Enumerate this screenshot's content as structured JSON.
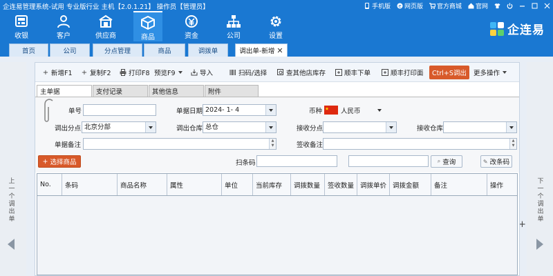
{
  "app_title": "企连易管理系统-试用 专业版行业 主机【2.0.1.21】 操作员【管理员】",
  "top_links": [
    {
      "label": "手机版",
      "icon": "mobile-icon"
    },
    {
      "label": "网页版",
      "icon": "ie-browser-icon"
    },
    {
      "label": "官方商城",
      "icon": "cart-icon"
    },
    {
      "label": "官网",
      "icon": "home-icon"
    }
  ],
  "nav_items": [
    {
      "label": "收银",
      "icon": "register-icon"
    },
    {
      "label": "客户",
      "icon": "customer-icon"
    },
    {
      "label": "供应商",
      "icon": "supplier-icon"
    },
    {
      "label": "商品",
      "icon": "product-box-icon"
    },
    {
      "label": "资金",
      "icon": "money-icon"
    },
    {
      "label": "公司",
      "icon": "company-org-icon"
    },
    {
      "label": "设置",
      "icon": "gear-icon"
    }
  ],
  "active_nav": "商品",
  "brand": "企连易",
  "tabs": [
    {
      "label": "首页"
    },
    {
      "label": "公司"
    },
    {
      "label": "分点管理"
    },
    {
      "label": "商品"
    },
    {
      "label": "调拨单"
    },
    {
      "label": "调出单-新增",
      "active": true
    }
  ],
  "toolbar": {
    "new": "新增F1",
    "copy": "复制F2",
    "print": "打印F8",
    "preview": "预览F9",
    "import": "导入",
    "scan": "扫码/选择",
    "check_stock": "查其他店库存",
    "sf_order": "顺丰下单",
    "sf_print": "顺丰打印面",
    "ctrl_s": "Ctrl+S调出",
    "more": "更多操作"
  },
  "subtabs": [
    "主单据",
    "支付记录",
    "其他信息",
    "附件"
  ],
  "form": {
    "order_no_label": "单号",
    "order_no_value": "",
    "date_label": "单据日期",
    "date_value": "2024- 1- 4",
    "currency_label": "币种",
    "currency_value": "人民币",
    "out_branch_label": "调出分点",
    "out_branch_value": "北京分部",
    "out_wh_label": "调出仓库",
    "out_wh_value": "总仓",
    "in_branch_label": "接收分点",
    "in_branch_value": "",
    "in_wh_label": "接收仓库",
    "in_wh_value": "",
    "remark_label": "单据备注",
    "remark_value": "",
    "sign_remark_label": "签收备注",
    "sign_remark_value": "",
    "select_goods": "选择商品",
    "barcode_label": "扫条码",
    "barcode_value": "",
    "search_value": "",
    "query": "查询",
    "change_barcode": "改条码"
  },
  "table": {
    "columns": [
      "No.",
      "条码",
      "商品名称",
      "属性",
      "单位",
      "当前库存",
      "调拨数量",
      "签收数量",
      "调拨单价",
      "调拨金额",
      "备注",
      "操作"
    ]
  },
  "left_side": {
    "label": "上一个调出单"
  },
  "right_side": {
    "label": "下一个调出单"
  },
  "colors": {
    "brand_blue": "#1a78d2",
    "red_button": "#d85a2a",
    "select_goods_button": "#d85a2a"
  }
}
